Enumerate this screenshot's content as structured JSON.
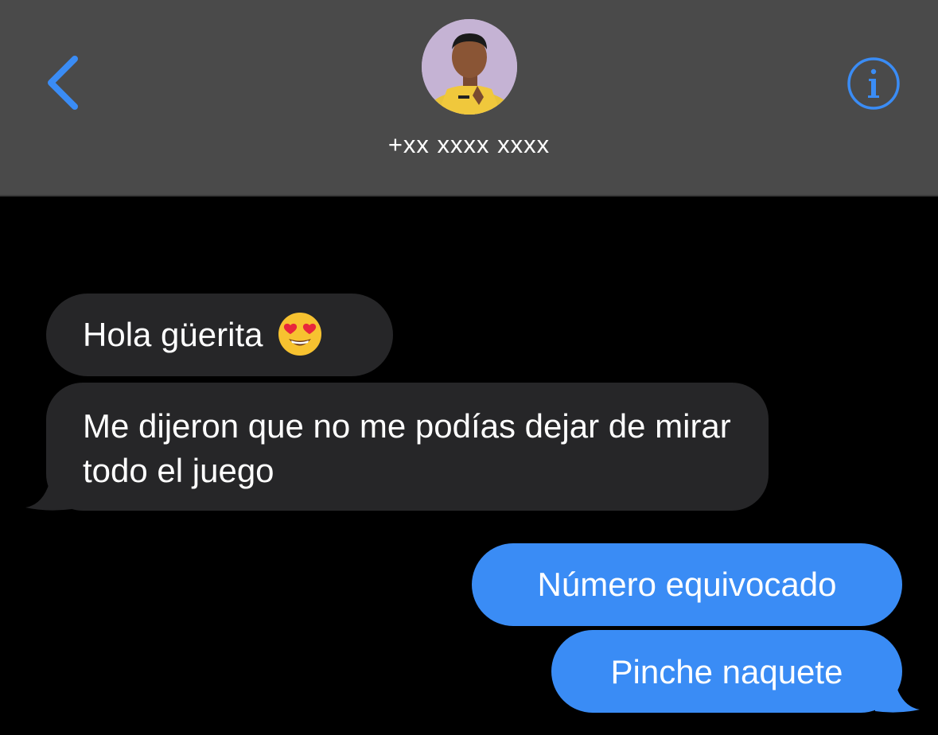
{
  "header": {
    "contact_name": "+xx xxxx xxxx",
    "back_icon": "chevron-left-icon",
    "info_icon": "info-circle-icon",
    "accent_color": "#3a8cf5"
  },
  "messages": [
    {
      "direction": "incoming",
      "text": "Hola güerita",
      "emoji": "heart-eyes-emoji"
    },
    {
      "direction": "incoming",
      "text": "Me dijeron que no me podías dejar de mirar todo el juego"
    },
    {
      "direction": "outgoing",
      "text": "Número equivocado"
    },
    {
      "direction": "outgoing",
      "text": "Pinche naquete"
    }
  ],
  "colors": {
    "header_bg": "#4a4a4a",
    "chat_bg": "#000000",
    "incoming_bubble": "#262628",
    "outgoing_bubble": "#3a8cf5"
  }
}
